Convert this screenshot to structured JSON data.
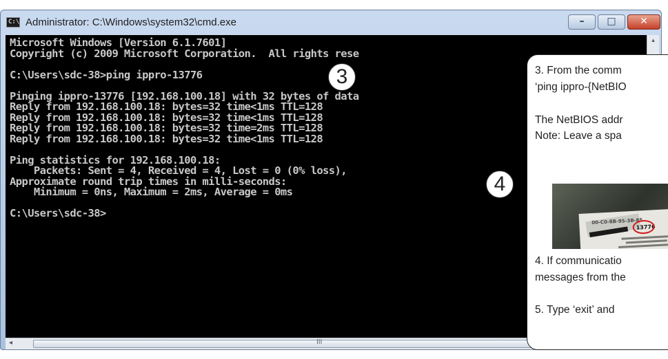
{
  "window": {
    "title": "Administrator: C:\\Windows\\system32\\cmd.exe",
    "icon": "cmd-icon",
    "icon_glyph": "C:\\",
    "buttons": {
      "minimize": "–",
      "maximize": "□",
      "close": "✕"
    }
  },
  "console": {
    "lines": [
      "Microsoft Windows [Version 6.1.7601]",
      "Copyright (c) 2009 Microsoft Corporation.  All rights rese",
      "",
      "C:\\Users\\sdc-38>ping ippro-13776",
      "",
      "Pinging ippro-13776 [192.168.100.18] with 32 bytes of data",
      "Reply from 192.168.100.18: bytes=32 time<1ms TTL=128",
      "Reply from 192.168.100.18: bytes=32 time<1ms TTL=128",
      "Reply from 192.168.100.18: bytes=32 time=2ms TTL=128",
      "Reply from 192.168.100.18: bytes=32 time<1ms TTL=128",
      "",
      "Ping statistics for 192.168.100.18:",
      "    Packets: Sent = 4, Received = 4, Lost = 0 (0% loss),",
      "Approximate round trip times in milli-seconds:",
      "    Minimum = 0ns, Maximum = 2ms, Average = 0ms",
      "",
      "C:\\Users\\sdc-38>"
    ]
  },
  "scrollbar": {
    "thumb_grip": "III",
    "left_arrow": "◂",
    "up_arrow": "▴"
  },
  "markers": {
    "step3": "3",
    "step4": "4"
  },
  "callout": {
    "lines": [
      "3.  From the comm",
      "‘ping ippro-{NetBIO",
      "",
      "The NetBIOS addr",
      "Note:  Leave a spa",
      "4.  If communicatio",
      "messages from the",
      "",
      "5.  Type ‘exit’ and"
    ],
    "photo": {
      "mac_text": "00-C0-8B-95-3B-85",
      "netbios_text": "13776"
    }
  },
  "colors": {
    "console_bg": "#000000",
    "console_text": "#c8c8c8",
    "close_button": "#c4412a",
    "highlight_oval": "#d01818"
  }
}
